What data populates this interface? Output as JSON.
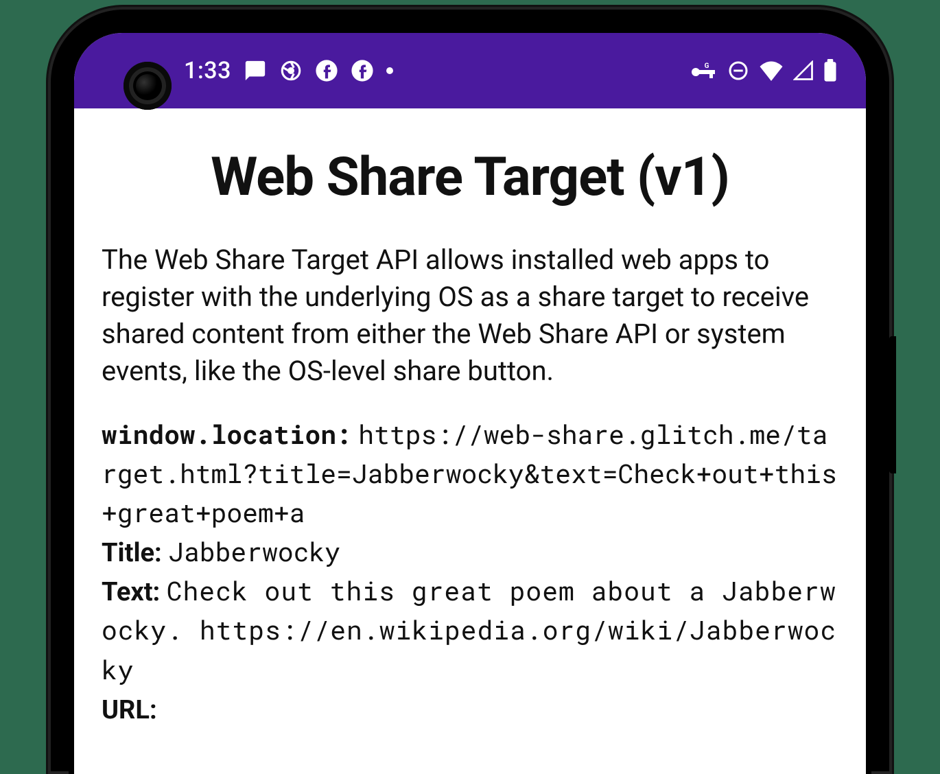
{
  "statusbar": {
    "time": "1:33"
  },
  "page": {
    "title": "Web Share Target (v1)",
    "description": "The Web Share Target API allows installed web apps to register with the underlying OS as a share target to receive shared content from either the Web Share API or system events, like the OS-level share button."
  },
  "fields": {
    "location_label": "window.location:",
    "location_value": "https://web-share.glitch.me/target.html?title=Jabberwocky&text=Check+out+this+great+poem+a",
    "title_label": "Title:",
    "title_value": "Jabberwocky",
    "text_label": "Text:",
    "text_value": "Check out this great poem about a Jabberwocky. https://en.wikipedia.org/wiki/Jabberwocky",
    "url_label": "URL:",
    "url_value": ""
  }
}
